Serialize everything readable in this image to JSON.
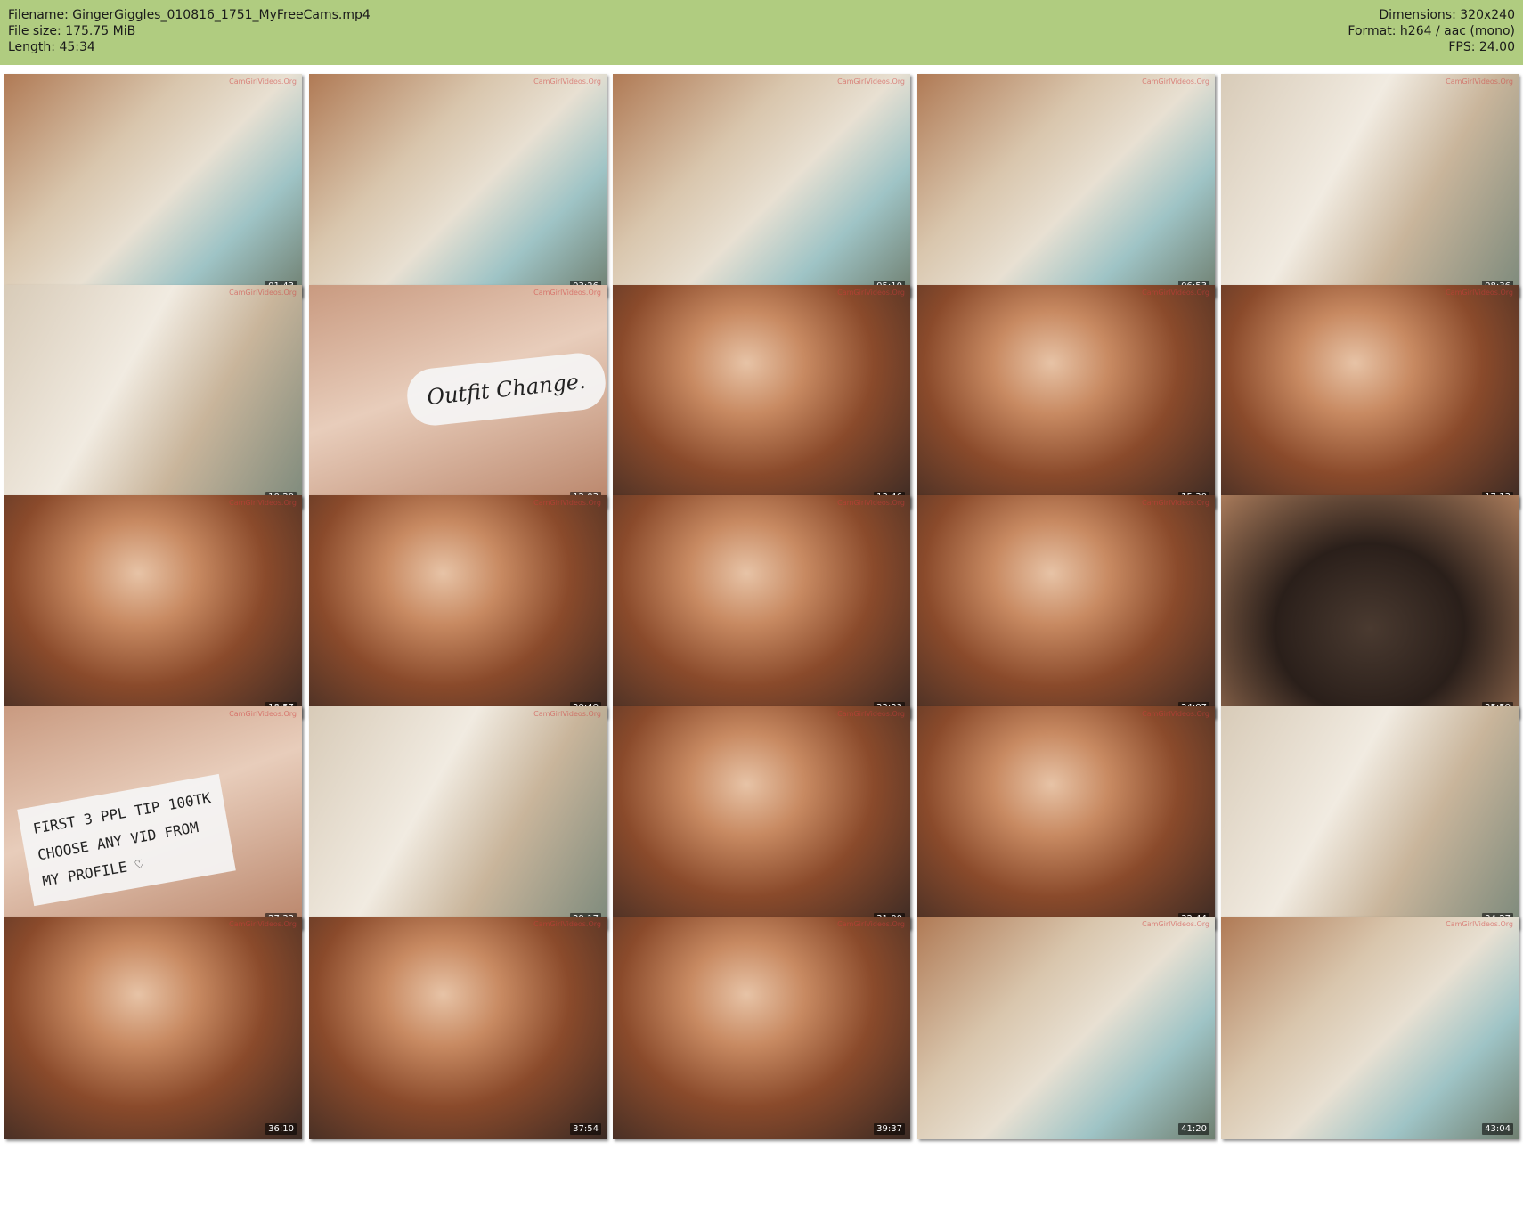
{
  "header": {
    "filename": "Filename: GingerGiggles_010816_1751_MyFreeCams.mp4",
    "filesize": "File size: 175.75 MiB",
    "length": "Length: 45:34",
    "dimensions": "Dimensions: 320x240",
    "format": "Format: h264 / aac (mono)",
    "fps": "FPS: 24.00"
  },
  "colors": {
    "header_bg": "#b0cc80"
  },
  "thumbnails": [
    {
      "time": "01:43",
      "scene": "room",
      "watermark": "CamGirlVideos.Org"
    },
    {
      "time": "03:26",
      "scene": "room",
      "watermark": "CamGirlVideos.Org"
    },
    {
      "time": "05:10",
      "scene": "room",
      "watermark": "CamGirlVideos.Org"
    },
    {
      "time": "06:53",
      "scene": "room",
      "watermark": "CamGirlVideos.Org"
    },
    {
      "time": "08:36",
      "scene": "mirror",
      "watermark": "CamGirlVideos.Org"
    },
    {
      "time": "10:20",
      "scene": "mirror",
      "watermark": "CamGirlVideos.Org"
    },
    {
      "time": "12:03",
      "scene": "note",
      "note": "Outfit Change.",
      "watermark": "CamGirlVideos.Org"
    },
    {
      "time": "13:46",
      "scene": "closeup",
      "watermark": "CamGirlVideos.Org"
    },
    {
      "time": "15:30",
      "scene": "closeup",
      "watermark": "CamGirlVideos.Org"
    },
    {
      "time": "17:13",
      "scene": "closeup",
      "watermark": "CamGirlVideos.Org"
    },
    {
      "time": "18:57",
      "scene": "closeup",
      "watermark": "CamGirlVideos.Org"
    },
    {
      "time": "20:40",
      "scene": "closeup",
      "watermark": "CamGirlVideos.Org"
    },
    {
      "time": "22:23",
      "scene": "closeup",
      "watermark": "CamGirlVideos.Org"
    },
    {
      "time": "24:07",
      "scene": "closeup",
      "watermark": "CamGirlVideos.Org"
    },
    {
      "time": "25:50",
      "scene": "dark",
      "watermark": ""
    },
    {
      "time": "27:33",
      "scene": "note",
      "note": "FIRST 3 PPL TIP 100TK\nCHOOSE ANY VID FROM\nMY PROFILE ♡",
      "watermark": "CamGirlVideos.Org"
    },
    {
      "time": "29:17",
      "scene": "mirror",
      "watermark": "CamGirlVideos.Org"
    },
    {
      "time": "31:00",
      "scene": "closeup",
      "watermark": "CamGirlVideos.Org"
    },
    {
      "time": "32:44",
      "scene": "closeup",
      "watermark": "CamGirlVideos.Org"
    },
    {
      "time": "34:27",
      "scene": "mirror",
      "watermark": ""
    },
    {
      "time": "36:10",
      "scene": "closeup",
      "watermark": "CamGirlVideos.Org"
    },
    {
      "time": "37:54",
      "scene": "closeup",
      "watermark": "CamGirlVideos.Org"
    },
    {
      "time": "39:37",
      "scene": "closeup",
      "watermark": "CamGirlVideos.Org"
    },
    {
      "time": "41:20",
      "scene": "room",
      "watermark": "CamGirlVideos.Org"
    },
    {
      "time": "43:04",
      "scene": "room",
      "watermark": "CamGirlVideos.Org"
    }
  ]
}
